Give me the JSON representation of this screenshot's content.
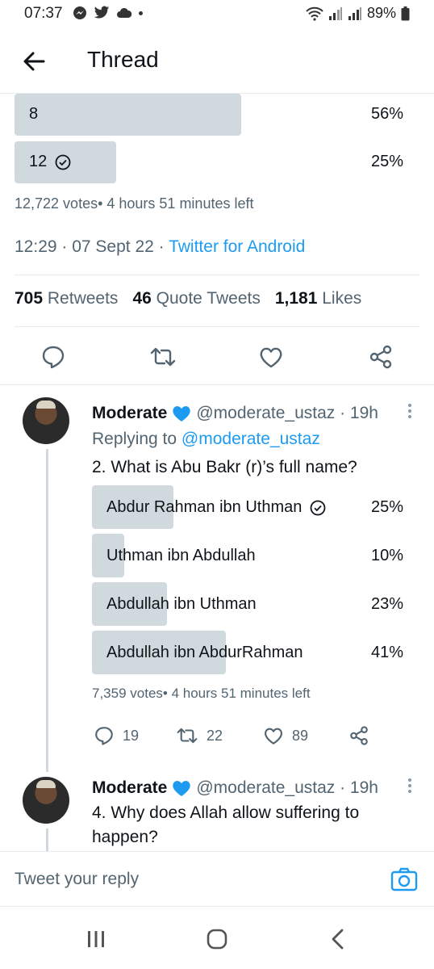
{
  "status_bar": {
    "time": "07:37",
    "battery": "89%",
    "icons": [
      "messenger-icon",
      "twitter-icon",
      "cloud-icon",
      "dot-icon",
      "wifi-icon",
      "signal-icon",
      "signal-icon",
      "battery-icon"
    ]
  },
  "header": {
    "title": "Thread",
    "back_icon": "arrow-left-icon"
  },
  "poll1": {
    "options": [
      {
        "label": "8",
        "percent": "56%",
        "fill": 0.56,
        "check": false
      },
      {
        "label": "12",
        "percent": "25%",
        "fill": 0.25,
        "check": true
      }
    ],
    "meta": "12,722 votes• 4 hours 51 minutes left"
  },
  "timestamp": {
    "time": "12:29 · 07 Sept 22 · ",
    "source": "Twitter for Android"
  },
  "stats": {
    "retweets_count": "705",
    "retweets_label": "Retweets",
    "quotes_count": "46",
    "quotes_label": "Quote Tweets",
    "likes_count": "1,181",
    "likes_label": "Likes"
  },
  "reply1": {
    "name": "Moderate",
    "handle": "@moderate_ustaz · 19h",
    "replying_prefix": "Replying to ",
    "replying_handle": "@moderate_ustaz",
    "text": "2. What is Abu Bakr (r)’s full name?",
    "poll": [
      {
        "label": "Abdur Rahman ibn Uthman",
        "percent": "25%",
        "fill": 0.25,
        "check": true
      },
      {
        "label": "Uthman ibn Abdullah",
        "percent": "10%",
        "fill": 0.1,
        "check": false
      },
      {
        "label": "Abdullah ibn Uthman",
        "percent": "23%",
        "fill": 0.23,
        "check": false
      },
      {
        "label": "Abdullah ibn AbdurRahman",
        "percent": "41%",
        "fill": 0.41,
        "check": false
      }
    ],
    "meta": "7,359 votes• 4 hours 51 minutes left",
    "replies": "19",
    "retweets": "22",
    "likes": "89"
  },
  "reply2": {
    "name": "Moderate",
    "handle": "@moderate_ustaz · 19h",
    "text": "4. Why does Allah allow suffering to happen?"
  },
  "compose": {
    "placeholder": "Tweet your reply"
  },
  "colors": {
    "accent": "#1d9bf0",
    "poll_fill": "#cfd9de",
    "muted_text": "#536471",
    "verified_heart": "#1d9bf0"
  }
}
